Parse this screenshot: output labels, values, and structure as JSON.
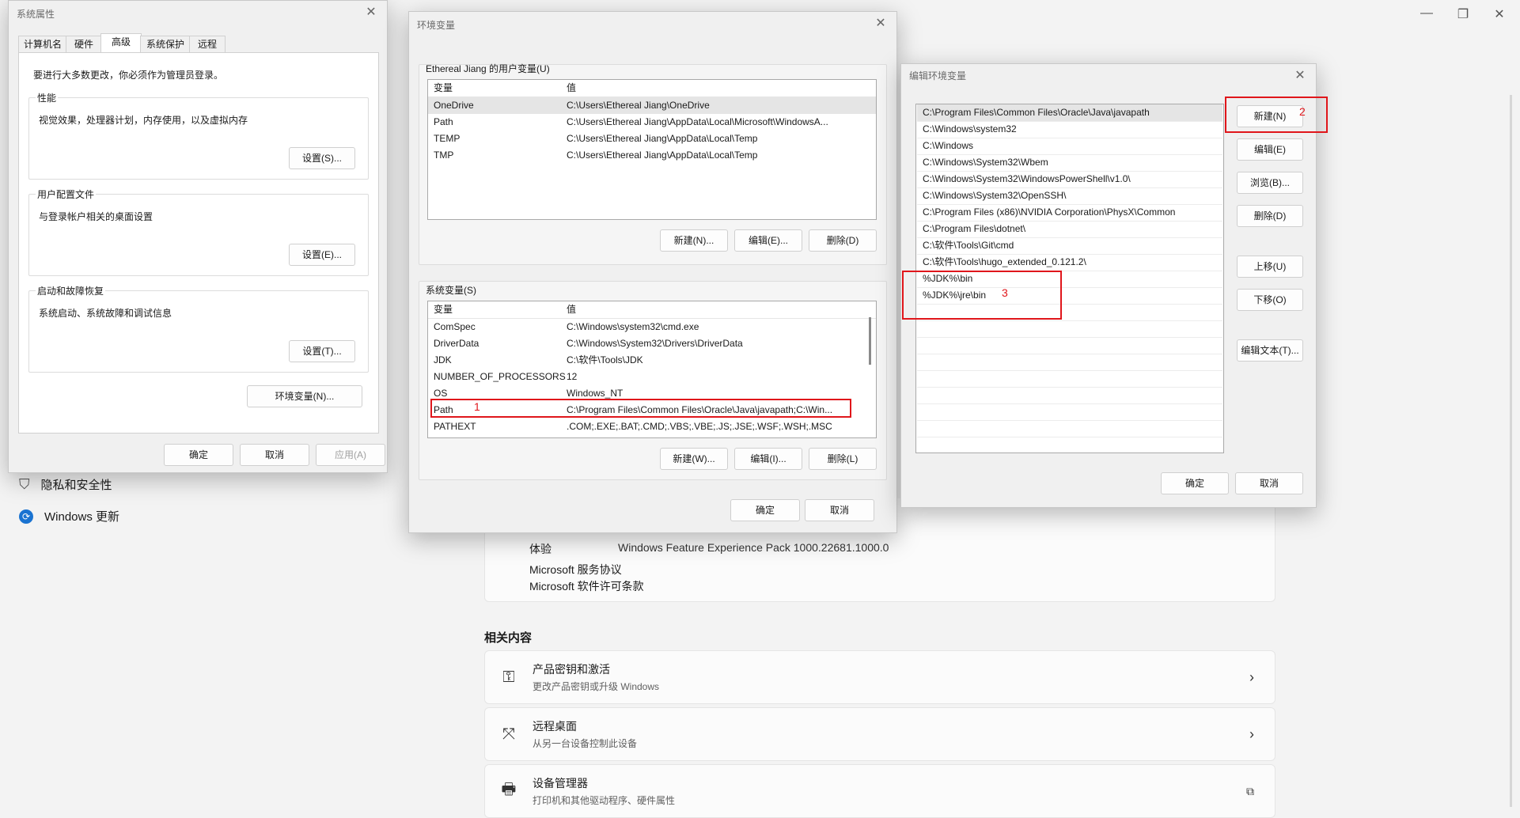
{
  "settings": {
    "nav": [
      {
        "label": "隐私和安全性",
        "icon": "shield-icon"
      },
      {
        "label": "Windows 更新",
        "icon": "update-icon"
      }
    ],
    "info_rows": [
      {
        "label": "体验",
        "value": "Windows Feature Experience Pack 1000.22681.1000.0"
      }
    ],
    "links": [
      "Microsoft 服务协议",
      "Microsoft 软件许可条款"
    ],
    "related_title": "相关内容",
    "related": [
      {
        "title": "产品密钥和激活",
        "subtitle": "更改产品密钥或升级 Windows",
        "icon": "key-icon",
        "action": "chevron-right-icon"
      },
      {
        "title": "远程桌面",
        "subtitle": "从另一台设备控制此设备",
        "icon": "remote-desktop-icon",
        "action": "chevron-right-icon"
      },
      {
        "title": "设备管理器",
        "subtitle": "打印机和其他驱动程序、硬件属性",
        "icon": "device-manager-icon",
        "action": "external-link-icon"
      }
    ]
  },
  "sysprops": {
    "title": "系统属性",
    "tabs": [
      "计算机名",
      "硬件",
      "高级",
      "系统保护",
      "远程"
    ],
    "active_tab": "高级",
    "admin_note": "要进行大多数更改，你必须作为管理员登录。",
    "groups": [
      {
        "title": "性能",
        "desc": "视觉效果，处理器计划，内存使用，以及虚拟内存",
        "button": "设置(S)..."
      },
      {
        "title": "用户配置文件",
        "desc": "与登录帐户相关的桌面设置",
        "button": "设置(E)..."
      },
      {
        "title": "启动和故障恢复",
        "desc": "系统启动、系统故障和调试信息",
        "button": "设置(T)..."
      }
    ],
    "env_button": "环境变量(N)...",
    "ok": "确定",
    "cancel": "取消",
    "apply": "应用(A)"
  },
  "envvars": {
    "title": "环境变量",
    "user_group": "Ethereal Jiang 的用户变量(U)",
    "col_var": "变量",
    "col_val": "值",
    "user_vars": [
      {
        "name": "OneDrive",
        "value": "C:\\Users\\Ethereal Jiang\\OneDrive"
      },
      {
        "name": "Path",
        "value": "C:\\Users\\Ethereal Jiang\\AppData\\Local\\Microsoft\\WindowsA..."
      },
      {
        "name": "TEMP",
        "value": "C:\\Users\\Ethereal Jiang\\AppData\\Local\\Temp"
      },
      {
        "name": "TMP",
        "value": "C:\\Users\\Ethereal Jiang\\AppData\\Local\\Temp"
      }
    ],
    "user_buttons": [
      "新建(N)...",
      "编辑(E)...",
      "删除(D)"
    ],
    "sys_group": "系统变量(S)",
    "sys_vars": [
      {
        "name": "ComSpec",
        "value": "C:\\Windows\\system32\\cmd.exe"
      },
      {
        "name": "DriverData",
        "value": "C:\\Windows\\System32\\Drivers\\DriverData"
      },
      {
        "name": "JDK",
        "value": "C:\\软件\\Tools\\JDK"
      },
      {
        "name": "NUMBER_OF_PROCESSORS",
        "value": "12"
      },
      {
        "name": "OS",
        "value": "Windows_NT"
      },
      {
        "name": "Path",
        "value": "C:\\Program Files\\Common Files\\Oracle\\Java\\javapath;C:\\Win..."
      },
      {
        "name": "PATHEXT",
        "value": ".COM;.EXE;.BAT;.CMD;.VBS;.VBE;.JS;.JSE;.WSF;.WSH;.MSC"
      }
    ],
    "sys_buttons": [
      "新建(W)...",
      "编辑(I)...",
      "删除(L)"
    ],
    "ok": "确定",
    "cancel": "取消"
  },
  "editenv": {
    "title": "编辑环境变量",
    "paths": [
      "C:\\Program Files\\Common Files\\Oracle\\Java\\javapath",
      "C:\\Windows\\system32",
      "C:\\Windows",
      "C:\\Windows\\System32\\Wbem",
      "C:\\Windows\\System32\\WindowsPowerShell\\v1.0\\",
      "C:\\Windows\\System32\\OpenSSH\\",
      "C:\\Program Files (x86)\\NVIDIA Corporation\\PhysX\\Common",
      "C:\\Program Files\\dotnet\\",
      "C:\\软件\\Tools\\Git\\cmd",
      "C:\\软件\\Tools\\hugo_extended_0.121.2\\",
      "%JDK%\\bin",
      "%JDK%\\jre\\bin"
    ],
    "buttons": [
      "新建(N)",
      "编辑(E)",
      "浏览(B)...",
      "删除(D)",
      "上移(U)",
      "下移(O)",
      "编辑文本(T)..."
    ],
    "ok": "确定",
    "cancel": "取消"
  },
  "annotations": [
    "1",
    "2",
    "3"
  ]
}
